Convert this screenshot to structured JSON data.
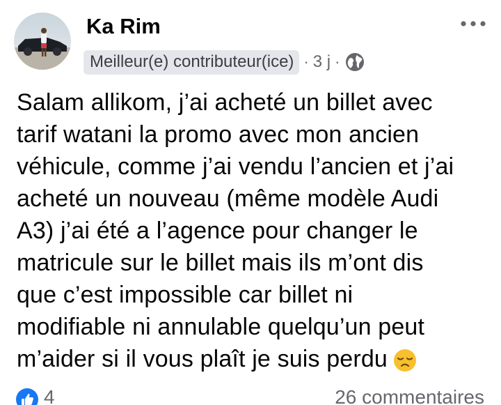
{
  "post": {
    "author": "Ka Rim",
    "badge": "Meilleur(e) contributeur(ice)",
    "separator": "·",
    "time": "3 j",
    "audience_icon": "globe-icon",
    "more_icon": "more-dots-icon",
    "body_lines": [
      "Salam allikom, j’ai acheté un billet avec",
      "tarif watani la promo avec mon ancien",
      "véhicule, comme j’ai vendu l’ancien et j’ai",
      "acheté un nouveau (même modèle Audi",
      "A3) j’ai été a l’agence pour changer le",
      "matricule sur le billet mais ils m’ont dis",
      "que c’est impossible car billet ni",
      "modifiable ni annulable quelqu’un peut",
      "m’aider si il vous plaît je suis perdu"
    ],
    "emoji": "disappointed-face-emoji"
  },
  "footer": {
    "reaction_icon": "like-icon",
    "likes": "4",
    "comments": "26 commentaires"
  },
  "colors": {
    "text": "#050505",
    "secondary_text": "#65676b",
    "badge_bg": "#e4e6eb",
    "like_blue": "#1877f2",
    "emoji_yellow": "#f7c02c"
  }
}
